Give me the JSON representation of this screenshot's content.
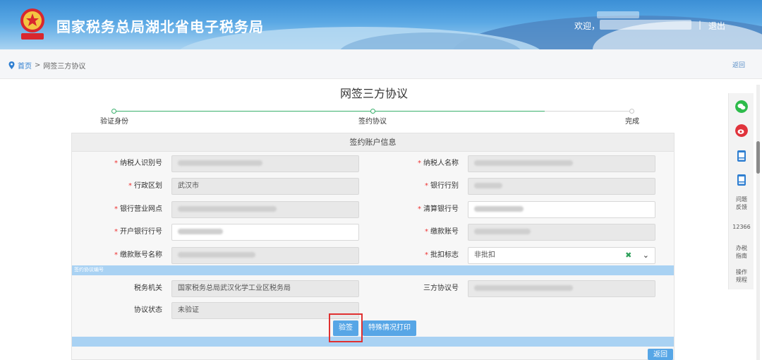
{
  "header": {
    "site_title": "国家税务总局湖北省电子税务局",
    "welcome": "欢迎，",
    "separator": "|",
    "logout": "退出"
  },
  "breadcrumb": {
    "home": "首页",
    "separator": ">",
    "current": "网签三方协议",
    "back": "返回"
  },
  "page": {
    "title": "网签三方协议"
  },
  "steps": [
    {
      "label": "验证身份",
      "state": "done"
    },
    {
      "label": "签约协议",
      "state": "active"
    },
    {
      "label": "完成",
      "state": "pending"
    }
  ],
  "form": {
    "section_title": "签约账户信息",
    "required_mark": "*",
    "fields": {
      "taxpayer_id": {
        "label": "纳税人识别号",
        "required": true,
        "value": ""
      },
      "taxpayer_name": {
        "label": "纳税人名称",
        "required": true,
        "value": ""
      },
      "region": {
        "label": "行政区划",
        "required": true,
        "value": "武汉市"
      },
      "bank_type": {
        "label": "银行行别",
        "required": true,
        "value": ""
      },
      "bank_branch": {
        "label": "银行营业网点",
        "required": true,
        "value": ""
      },
      "clearing_bank_no": {
        "label": "清算银行号",
        "required": true,
        "value": ""
      },
      "opening_bank_no": {
        "label": "开户银行行号",
        "required": true,
        "value": ""
      },
      "pay_account": {
        "label": "缴款账号",
        "required": true,
        "value": ""
      },
      "pay_account_name": {
        "label": "缴款账号名称",
        "required": true,
        "value": ""
      },
      "batch_flag": {
        "label": "批扣标志",
        "required": true,
        "value": "非批扣",
        "clear_icon": "✖",
        "dropdown_icon": "⌄"
      }
    },
    "agreement_section": "签约协议编号",
    "agreement": {
      "tax_office": {
        "label": "税务机关",
        "value": "国家税务总局武汉化学工业区税务局"
      },
      "agreement_no": {
        "label": "三方协议号",
        "value": ""
      },
      "status": {
        "label": "协议状态",
        "value": "未验证"
      }
    },
    "buttons": {
      "verify": "验签",
      "special_print": "特殊情况打印",
      "back": "返回"
    }
  },
  "sidebar": {
    "feedback": "问题反馈",
    "hotline": "12366",
    "guide": "办税指南",
    "manual": "操作规程"
  },
  "colors": {
    "header_blue": "#3b8fd6",
    "accent_blue": "#57a6e6",
    "step_green": "#3ab06c",
    "required_red": "#e33333",
    "highlight_red": "#e03131"
  }
}
